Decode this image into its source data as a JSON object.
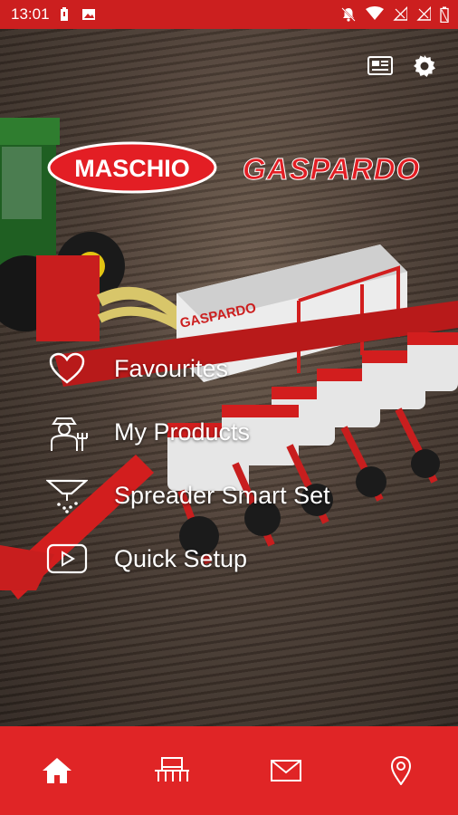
{
  "status": {
    "time": "13:01"
  },
  "brands": {
    "left": "MASCHIO",
    "right": "GASPARDO",
    "machine_text": "GASPARDO"
  },
  "menu": [
    {
      "label": "Favourites",
      "icon": "heart-icon"
    },
    {
      "label": "My Products",
      "icon": "farmer-icon"
    },
    {
      "label": "Spreader Smart Set",
      "icon": "spreader-icon"
    },
    {
      "label": "Quick Setup",
      "icon": "play-video-icon"
    }
  ],
  "bottom_nav": [
    "home-icon",
    "machine-icon",
    "mail-icon",
    "location-pin-icon"
  ],
  "colors": {
    "brand_red": "#e02526",
    "status_red": "#cc1f1f"
  }
}
